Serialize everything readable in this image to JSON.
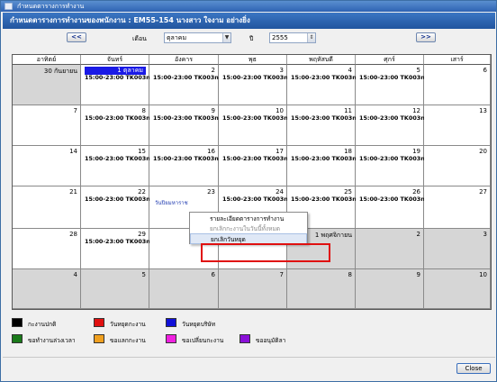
{
  "window": {
    "title": "กำหนดตารางการทำงาน"
  },
  "header": {
    "title": "กำหนดตารางการทำงานของพนักงาน : EM55-154  นางสาว ใจงาม อย่างยิ่ง"
  },
  "nav": {
    "prev_label": "<<",
    "next_label": ">>",
    "month_label": "เดือน",
    "month_value": "ตุลาคม",
    "year_label": "ปี",
    "year_value": "2555"
  },
  "weekdays": [
    "อาทิตย์",
    "จันทร์",
    "อังคาร",
    "พุธ",
    "พฤหัสบดี",
    "ศุกร์",
    "เสาร์"
  ],
  "weeks": [
    [
      {
        "day": "30 กันยายน",
        "shift": "",
        "gray": true
      },
      {
        "day": "1 ตุลาคม",
        "shift": "15:00-23:00 TK003ne",
        "selected": true
      },
      {
        "day": "2",
        "shift": "15:00-23:00 TK003ne"
      },
      {
        "day": "3",
        "shift": "15:00-23:00 TK003ne"
      },
      {
        "day": "4",
        "shift": "15:00-23:00 TK003ne"
      },
      {
        "day": "5",
        "shift": "15:00-23:00 TK003ne"
      },
      {
        "day": "6",
        "shift": ""
      }
    ],
    [
      {
        "day": "7",
        "shift": ""
      },
      {
        "day": "8",
        "shift": "15:00-23:00 TK003ne"
      },
      {
        "day": "9",
        "shift": "15:00-23:00 TK003ne"
      },
      {
        "day": "10",
        "shift": "15:00-23:00 TK003ne"
      },
      {
        "day": "11",
        "shift": "15:00-23:00 TK003ne"
      },
      {
        "day": "12",
        "shift": "15:00-23:00 TK003ne"
      },
      {
        "day": "13",
        "shift": ""
      }
    ],
    [
      {
        "day": "14",
        "shift": ""
      },
      {
        "day": "15",
        "shift": "15:00-23:00 TK003ne"
      },
      {
        "day": "16",
        "shift": "15:00-23:00 TK003ne"
      },
      {
        "day": "17",
        "shift": "15:00-23:00 TK003ne"
      },
      {
        "day": "18",
        "shift": "15:00-23:00 TK003ne"
      },
      {
        "day": "19",
        "shift": "15:00-23:00 TK003ne"
      },
      {
        "day": "20",
        "shift": ""
      }
    ],
    [
      {
        "day": "21",
        "shift": ""
      },
      {
        "day": "22",
        "shift": "15:00-23:00 TK003ne"
      },
      {
        "day": "23",
        "shift": "",
        "holiday": "วันปิยมหาราช"
      },
      {
        "day": "24",
        "shift": "15:00-23:00 TK003ne"
      },
      {
        "day": "25",
        "shift": "15:00-23:00 TK003ne"
      },
      {
        "day": "26",
        "shift": "15:00-23:00 TK003ne"
      },
      {
        "day": "27",
        "shift": ""
      }
    ],
    [
      {
        "day": "28",
        "shift": ""
      },
      {
        "day": "29",
        "shift": "15:00-23:00 TK003ne"
      },
      {
        "day": "",
        "shift": ""
      },
      {
        "day": "",
        "shift": ""
      },
      {
        "day": "1 พฤศจิกายน",
        "shift": "",
        "gray": true
      },
      {
        "day": "2",
        "shift": "",
        "gray": true
      },
      {
        "day": "3",
        "shift": "",
        "gray": true
      }
    ],
    [
      {
        "day": "4",
        "shift": "",
        "gray": true
      },
      {
        "day": "5",
        "shift": "",
        "gray": true
      },
      {
        "day": "6",
        "shift": "",
        "gray": true
      },
      {
        "day": "7",
        "shift": "",
        "gray": true
      },
      {
        "day": "8",
        "shift": "",
        "gray": true
      },
      {
        "day": "9",
        "shift": "",
        "gray": true
      },
      {
        "day": "10",
        "shift": "",
        "gray": true
      }
    ]
  ],
  "context_menu": {
    "items": [
      {
        "label": "รายละเอียดตารางการทำงาน",
        "state": "normal"
      },
      {
        "label": "ยกเลิกกะงานในวันนี้ทั้งหมด",
        "state": "disabled"
      },
      {
        "label": "ยกเลิกวันหยุด",
        "state": "hover"
      }
    ]
  },
  "legend": [
    {
      "label": "กะงานปกติ",
      "color": "#000000"
    },
    {
      "label": "วันหยุดกะงาน",
      "color": "#e01010"
    },
    {
      "label": "วันหยุดบริษัท",
      "color": "#1010d8"
    },
    {
      "label": "ขอทำงานล่วงเวลา",
      "color": "#1a7a1a"
    },
    {
      "label": "ขอแลกกะงาน",
      "color": "#f0a020"
    },
    {
      "label": "ขอเปลี่ยนกะงาน",
      "color": "#f020e0"
    },
    {
      "label": "ขออนุมัติลา",
      "color": "#8a10d8"
    }
  ],
  "footer": {
    "close_label": "Close"
  }
}
